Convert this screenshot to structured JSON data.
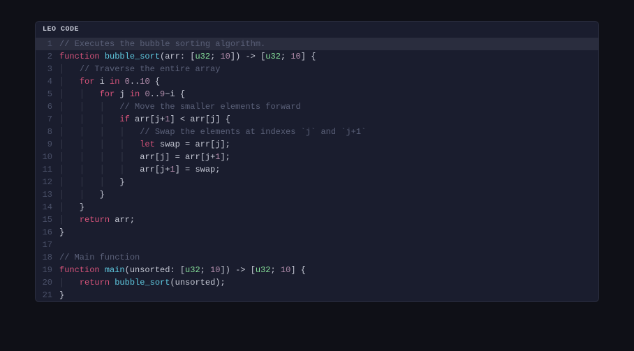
{
  "header": {
    "title": "LEO CODE"
  },
  "code": {
    "line_numbers": [
      "1",
      "2",
      "3",
      "4",
      "5",
      "6",
      "7",
      "8",
      "9",
      "10",
      "11",
      "12",
      "13",
      "14",
      "15",
      "16",
      "17",
      "18",
      "19",
      "20",
      "21"
    ],
    "highlighted_line": 1,
    "tokens": {
      "comment_exec": "// Executes the bubble sorting algorithm.",
      "kw_function": "function",
      "fn_bubble_sort": "bubble_sort",
      "param_arr": "arr",
      "type_u32a": "u32",
      "num_10": "10",
      "arrow": "->",
      "lbrace": "{",
      "rbrace": "}",
      "lparen": "(",
      "rparen": ")",
      "lbrack": "[",
      "rbrack": "]",
      "colon": ":",
      "semi": ";",
      "comment_traverse": "// Traverse the entire array",
      "kw_for": "for",
      "ident_i": "i",
      "ident_j": "j",
      "kw_in": "in",
      "num_0": "0",
      "range": "..",
      "num_9": "9",
      "minus": "−",
      "comment_move": "// Move the smaller elements forward",
      "kw_if": "if",
      "plus": "+",
      "num_1": "1",
      "lt": "<",
      "comment_swap": "// Swap the elements at indexes `j` and `j+1`",
      "kw_let": "let",
      "ident_swap": "swap",
      "eq": "=",
      "kw_return": "return",
      "comment_main": "// Main function",
      "fn_main": "main",
      "param_unsorted": "unsorted",
      "space": " "
    }
  }
}
